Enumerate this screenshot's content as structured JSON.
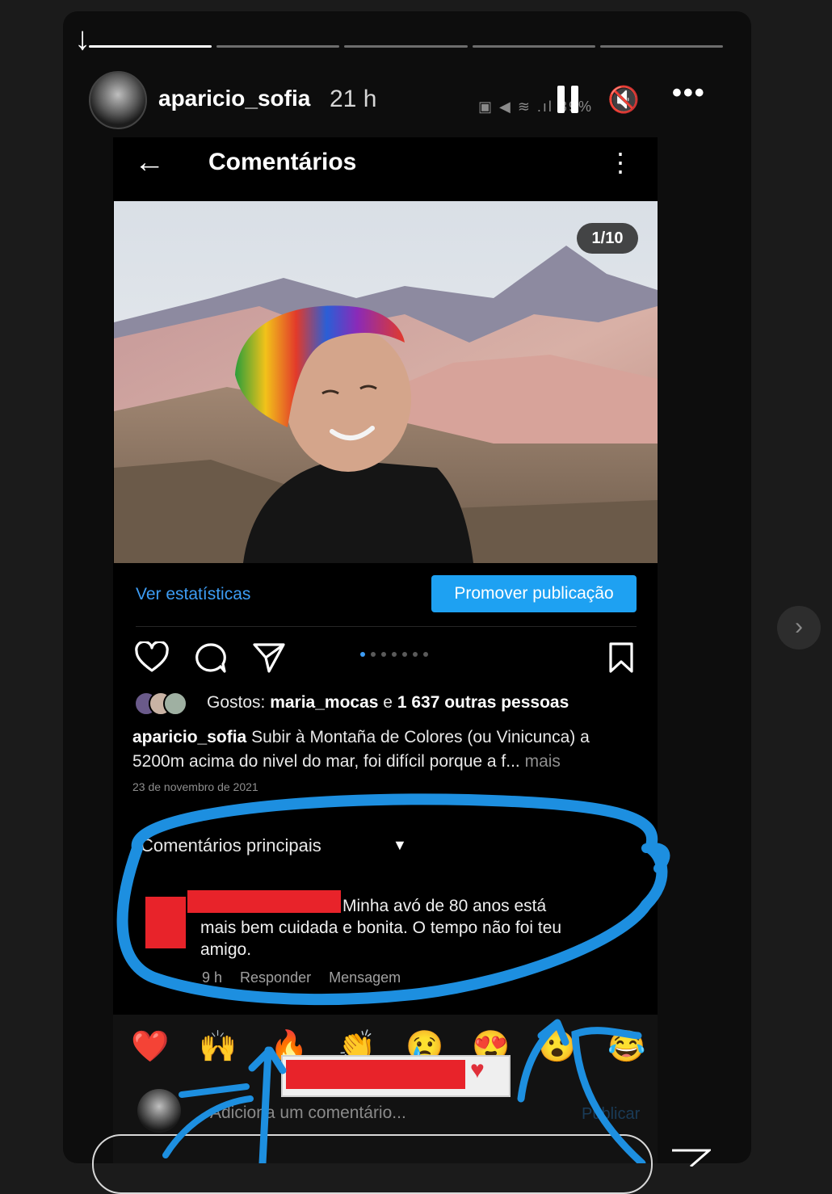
{
  "story": {
    "username": "aparicio_sofia",
    "time": "21 h",
    "statusbar": "▣ ◀ ≋ .ıl 89%",
    "segments": 5
  },
  "screen": {
    "title": "Comentários",
    "photo_counter": "1/10",
    "stats_link": "Ver estatísticas",
    "promote_button": "Promover publicação",
    "carousel_dots": 7,
    "likes": {
      "prefix": "Gostos: ",
      "user": "maria_mocas",
      "connector": " e ",
      "others": "1 637 outras pessoas"
    },
    "caption": {
      "user": "aparicio_sofia",
      "text": " Subir à Montaña de Colores (ou Vinicunca) a 5200m acima do nivel do mar, foi difícil porque a f...",
      "more": " mais"
    },
    "date": "23 de novembro de 2021",
    "sort_label": "Comentários principais",
    "comment": {
      "text": "Minha avó de 80 anos está mais bem cuidada e bonita. O tempo não foi teu amigo.",
      "time": "9 h",
      "reply": "Responder",
      "message": "Mensagem"
    },
    "emojis": [
      "❤️",
      "🙌",
      "🔥",
      "👏",
      "😢",
      "😍",
      "😮",
      "😂"
    ],
    "add_comment_placeholder": "Adiciona um comentário...",
    "publish": "Publicar"
  },
  "colors": {
    "accent_blue": "#1ea1f2",
    "redaction": "#e8232a",
    "annotation": "#1d8fe0"
  }
}
